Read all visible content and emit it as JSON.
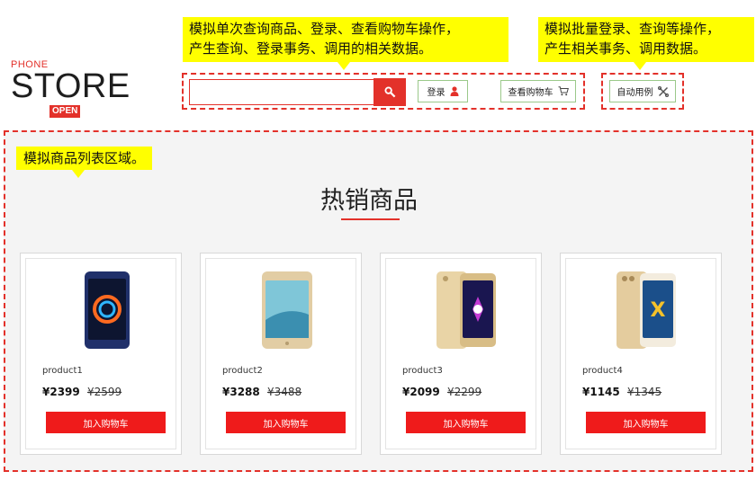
{
  "logo": {
    "phone": "PHONE",
    "store": "STORE",
    "open": "OPEN"
  },
  "callouts": {
    "single_line1": "模拟单次查询商品、登录、查看购物车操作，",
    "single_line2": "产生查询、登录事务、调用的相关数据。",
    "batch_line1": "模拟批量登录、查询等操作，",
    "batch_line2": "产生相关事务、调用数据。",
    "list": "模拟商品列表区域。"
  },
  "search": {
    "value": "",
    "placeholder": "",
    "icon": "search-icon"
  },
  "header": {
    "login_label": "登录",
    "login_icon": "user-icon",
    "cart_label": "查看购物车",
    "cart_icon": "cart-icon",
    "auto_label": "自动用例",
    "auto_icon": "tools-icon"
  },
  "section": {
    "title": "热销商品"
  },
  "products": [
    {
      "name": "product1",
      "price": "¥2399",
      "old_price": "¥2599",
      "button": "加入购物车",
      "phone_color": "#2a3a7a"
    },
    {
      "name": "product2",
      "price": "¥3288",
      "old_price": "¥3488",
      "button": "加入购物车",
      "phone_color": "#d9c39a"
    },
    {
      "name": "product3",
      "price": "¥2099",
      "old_price": "¥2299",
      "button": "加入购物车",
      "phone_color": "#e2cc9c"
    },
    {
      "name": "product4",
      "price": "¥1145",
      "old_price": "¥1345",
      "button": "加入购物车",
      "phone_color": "#dcc6a0"
    }
  ],
  "colors": {
    "accent": "#e3312a",
    "callout": "#ffff00",
    "button_border": "#9bc98a",
    "list_bg": "#f4f4f4"
  }
}
